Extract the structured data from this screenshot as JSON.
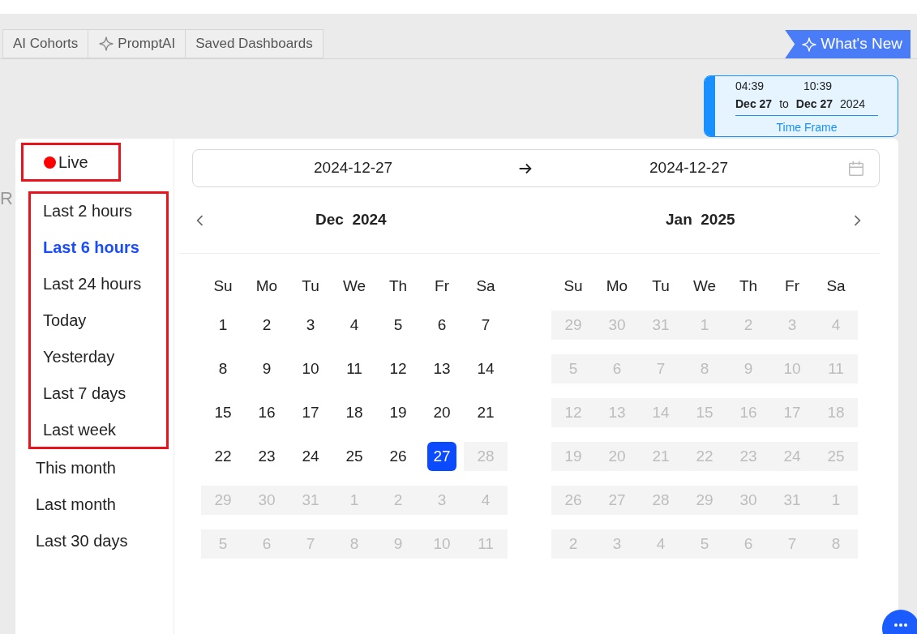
{
  "tabs": [
    {
      "label": "AI Cohorts",
      "kind": "plain"
    },
    {
      "label": "PromptAI",
      "kind": "sparkle"
    },
    {
      "label": "Saved Dashboards",
      "kind": "plain"
    }
  ],
  "whats_new": {
    "label": "What's New"
  },
  "time_frame": {
    "start_time": "04:39",
    "end_time": "10:39",
    "start_date": "Dec 27",
    "separator": "to",
    "end_date": "Dec 27",
    "year": "2024",
    "caption": "Time Frame"
  },
  "background_fragments": [
    "R"
  ],
  "preset_groups": [
    {
      "highlighted": true,
      "items": [
        {
          "label": "Live",
          "kind": "live",
          "selected": false
        }
      ]
    },
    {
      "highlighted": true,
      "items": [
        {
          "label": "Last 2 hours",
          "kind": "plain",
          "selected": false
        },
        {
          "label": "Last 6 hours",
          "kind": "plain",
          "selected": true
        },
        {
          "label": "Last 24 hours",
          "kind": "plain",
          "selected": false
        },
        {
          "label": "Today",
          "kind": "plain",
          "selected": false
        },
        {
          "label": "Yesterday",
          "kind": "plain",
          "selected": false
        },
        {
          "label": "Last 7 days",
          "kind": "plain",
          "selected": false
        },
        {
          "label": "Last week",
          "kind": "plain",
          "selected": false
        }
      ]
    },
    {
      "highlighted": false,
      "items": [
        {
          "label": "This month",
          "kind": "plain",
          "selected": false
        },
        {
          "label": "Last month",
          "kind": "plain",
          "selected": false
        },
        {
          "label": "Last 30 days",
          "kind": "plain",
          "selected": false
        }
      ]
    }
  ],
  "range": {
    "start": "2024-12-27",
    "end": "2024-12-27"
  },
  "months": [
    {
      "month": "Dec",
      "year": "2024",
      "weekdays": [
        "Su",
        "Mo",
        "Tu",
        "We",
        "Th",
        "Fr",
        "Sa"
      ],
      "weeks": [
        [
          {
            "d": "1",
            "muted": false,
            "selected": false
          },
          {
            "d": "2",
            "muted": false,
            "selected": false
          },
          {
            "d": "3",
            "muted": false,
            "selected": false
          },
          {
            "d": "4",
            "muted": false,
            "selected": false
          },
          {
            "d": "5",
            "muted": false,
            "selected": false
          },
          {
            "d": "6",
            "muted": false,
            "selected": false
          },
          {
            "d": "7",
            "muted": false,
            "selected": false
          }
        ],
        [
          {
            "d": "8",
            "muted": false,
            "selected": false
          },
          {
            "d": "9",
            "muted": false,
            "selected": false
          },
          {
            "d": "10",
            "muted": false,
            "selected": false
          },
          {
            "d": "11",
            "muted": false,
            "selected": false
          },
          {
            "d": "12",
            "muted": false,
            "selected": false
          },
          {
            "d": "13",
            "muted": false,
            "selected": false
          },
          {
            "d": "14",
            "muted": false,
            "selected": false
          }
        ],
        [
          {
            "d": "15",
            "muted": false,
            "selected": false
          },
          {
            "d": "16",
            "muted": false,
            "selected": false
          },
          {
            "d": "17",
            "muted": false,
            "selected": false
          },
          {
            "d": "18",
            "muted": false,
            "selected": false
          },
          {
            "d": "19",
            "muted": false,
            "selected": false
          },
          {
            "d": "20",
            "muted": false,
            "selected": false
          },
          {
            "d": "21",
            "muted": false,
            "selected": false
          }
        ],
        [
          {
            "d": "22",
            "muted": false,
            "selected": false
          },
          {
            "d": "23",
            "muted": false,
            "selected": false
          },
          {
            "d": "24",
            "muted": false,
            "selected": false
          },
          {
            "d": "25",
            "muted": false,
            "selected": false
          },
          {
            "d": "26",
            "muted": false,
            "selected": false
          },
          {
            "d": "27",
            "muted": false,
            "selected": true
          },
          {
            "d": "28",
            "muted": true,
            "selected": false
          }
        ],
        [
          {
            "d": "29",
            "muted": true,
            "selected": false
          },
          {
            "d": "30",
            "muted": true,
            "selected": false
          },
          {
            "d": "31",
            "muted": true,
            "selected": false
          },
          {
            "d": "1",
            "muted": true,
            "selected": false
          },
          {
            "d": "2",
            "muted": true,
            "selected": false
          },
          {
            "d": "3",
            "muted": true,
            "selected": false
          },
          {
            "d": "4",
            "muted": true,
            "selected": false
          }
        ],
        [
          {
            "d": "5",
            "muted": true,
            "selected": false
          },
          {
            "d": "6",
            "muted": true,
            "selected": false
          },
          {
            "d": "7",
            "muted": true,
            "selected": false
          },
          {
            "d": "8",
            "muted": true,
            "selected": false
          },
          {
            "d": "9",
            "muted": true,
            "selected": false
          },
          {
            "d": "10",
            "muted": true,
            "selected": false
          },
          {
            "d": "11",
            "muted": true,
            "selected": false
          }
        ]
      ]
    },
    {
      "month": "Jan",
      "year": "2025",
      "weekdays": [
        "Su",
        "Mo",
        "Tu",
        "We",
        "Th",
        "Fr",
        "Sa"
      ],
      "weeks": [
        [
          {
            "d": "29",
            "muted": true,
            "selected": false
          },
          {
            "d": "30",
            "muted": true,
            "selected": false
          },
          {
            "d": "31",
            "muted": true,
            "selected": false
          },
          {
            "d": "1",
            "muted": true,
            "selected": false
          },
          {
            "d": "2",
            "muted": true,
            "selected": false
          },
          {
            "d": "3",
            "muted": true,
            "selected": false
          },
          {
            "d": "4",
            "muted": true,
            "selected": false
          }
        ],
        [
          {
            "d": "5",
            "muted": true,
            "selected": false
          },
          {
            "d": "6",
            "muted": true,
            "selected": false
          },
          {
            "d": "7",
            "muted": true,
            "selected": false
          },
          {
            "d": "8",
            "muted": true,
            "selected": false
          },
          {
            "d": "9",
            "muted": true,
            "selected": false
          },
          {
            "d": "10",
            "muted": true,
            "selected": false
          },
          {
            "d": "11",
            "muted": true,
            "selected": false
          }
        ],
        [
          {
            "d": "12",
            "muted": true,
            "selected": false
          },
          {
            "d": "13",
            "muted": true,
            "selected": false
          },
          {
            "d": "14",
            "muted": true,
            "selected": false
          },
          {
            "d": "15",
            "muted": true,
            "selected": false
          },
          {
            "d": "16",
            "muted": true,
            "selected": false
          },
          {
            "d": "17",
            "muted": true,
            "selected": false
          },
          {
            "d": "18",
            "muted": true,
            "selected": false
          }
        ],
        [
          {
            "d": "19",
            "muted": true,
            "selected": false
          },
          {
            "d": "20",
            "muted": true,
            "selected": false
          },
          {
            "d": "21",
            "muted": true,
            "selected": false
          },
          {
            "d": "22",
            "muted": true,
            "selected": false
          },
          {
            "d": "23",
            "muted": true,
            "selected": false
          },
          {
            "d": "24",
            "muted": true,
            "selected": false
          },
          {
            "d": "25",
            "muted": true,
            "selected": false
          }
        ],
        [
          {
            "d": "26",
            "muted": true,
            "selected": false
          },
          {
            "d": "27",
            "muted": true,
            "selected": false
          },
          {
            "d": "28",
            "muted": true,
            "selected": false
          },
          {
            "d": "29",
            "muted": true,
            "selected": false
          },
          {
            "d": "30",
            "muted": true,
            "selected": false
          },
          {
            "d": "31",
            "muted": true,
            "selected": false
          },
          {
            "d": "1",
            "muted": true,
            "selected": false
          }
        ],
        [
          {
            "d": "2",
            "muted": true,
            "selected": false
          },
          {
            "d": "3",
            "muted": true,
            "selected": false
          },
          {
            "d": "4",
            "muted": true,
            "selected": false
          },
          {
            "d": "5",
            "muted": true,
            "selected": false
          },
          {
            "d": "6",
            "muted": true,
            "selected": false
          },
          {
            "d": "7",
            "muted": true,
            "selected": false
          },
          {
            "d": "8",
            "muted": true,
            "selected": false
          }
        ]
      ]
    }
  ]
}
